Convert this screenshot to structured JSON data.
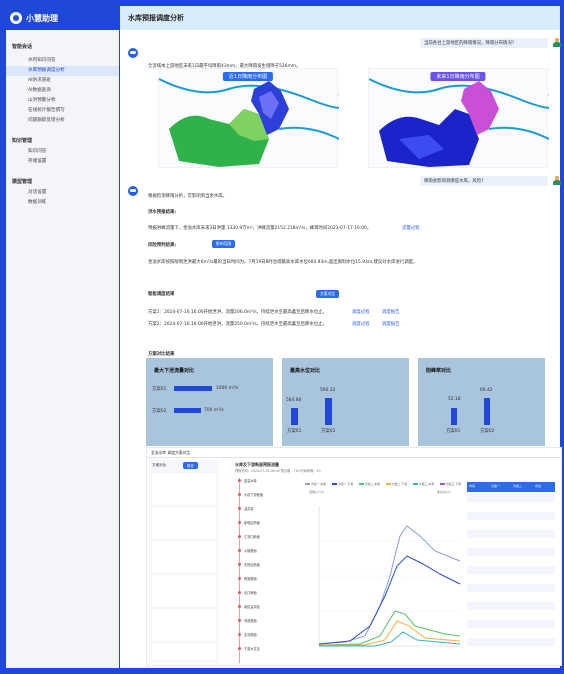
{
  "app": {
    "name": "小慧助理",
    "page_title": "水库预报调度分析"
  },
  "sidebar": {
    "sections": [
      {
        "title": "智能会话",
        "items": [
          "水利知识问答",
          "水库预报调度分析",
          "AI防汛值班",
          "AI数据查询",
          "山洪预警分析",
          "在线统计报告撰写",
          "问题跟踪反馈分析"
        ],
        "active": 1
      },
      {
        "title": "知识管理",
        "items": [
          "知识问答",
          "存储设置"
        ]
      },
      {
        "title": "模型管理",
        "items": [
          "对话设置",
          "数据训练"
        ]
      }
    ]
  },
  "chat": {
    "q1": "当前各台上游地区的降雨情况，降雨分布情况?",
    "a1": "全流域本上游地区未来1日最平均降雨43mm，最大降雨发生增降于526mm。",
    "map_left_title": "近1日降雨分布图",
    "map_right_title": "未来1日降雨分布图",
    "q2": "降雨会影响到哪些水库，风险?",
    "a2_intro": "根据检测降雨分析，可影响到当金水库。",
    "forecast_heading": "洪水预报结果:",
    "forecast_text": "预报洪峰流量下，金溢水库未来3日洪量 1330.9万m³，洪峰流量2152.218m³/s，峰现时间2023-07-17 16:00。",
    "forecast_link": "流量过程",
    "risk_heading": "风险预判结果:",
    "risk_button": "影响范围",
    "risk_text": "金溢水库按照限制泄洪最大6m³/s最的当日时间为，7月19日8时治理最高水库水位604.93m,超出限制水位15.93m,建议对水库进行调度。",
    "dispatch_heading": "智能调度结果",
    "dispatch_button": "方案对比",
    "plan1": "方案1：2024-07-16 16:00开始泄洪，流量206.0m³/s，持续泄水至最高蓄至后降水位止。",
    "plan2": "方案2：2024-07-16 16:00开始泄洪，流量250.0m³/s，持续泄水至最高蓄至后降水位止。",
    "plan_link1": "调度过程",
    "plan_link2": "调度报告",
    "compare_heading": "方案对比结果"
  },
  "cards": [
    {
      "title": "最大下泄流量对比",
      "bars": [
        {
          "label": "方案01",
          "value": 1000,
          "unit": "m³/s"
        },
        {
          "label": "方案02",
          "value": 700,
          "unit": "m³/s"
        }
      ]
    },
    {
      "title": "最高水位对比",
      "bars": [
        {
          "label": "方案01",
          "value": 584.86
        },
        {
          "label": "方案02",
          "value": 590.32
        }
      ]
    },
    {
      "title": "削峰率对比",
      "bars": [
        {
          "label": "方案01",
          "value": 52.18
        },
        {
          "label": "方案02",
          "value": 66.42
        }
      ]
    }
  ],
  "embedded": {
    "title": "金溢水库 调度方案对比",
    "tab_a": "方案对比",
    "tab_b": "报告",
    "chart_title": "水库及下游断面预报流量",
    "chart_subtitle": "预报时间：2024-07-16 08:00 预见期：72h 时间间隔：1h",
    "ylabel_left": "流量(m³/s)",
    "ylabel_right": "库水位(m)",
    "legend": [
      "方案一-水库",
      "方案一-下游",
      "方案二-水库",
      "方案二-下游",
      "方案三-水库",
      "方案三-下游"
    ],
    "station_list": [
      "金溢水库",
      "大坝下游断面",
      "溢洪道",
      "新城区断面",
      "汇流口断面",
      "乡镇断面",
      "农田区断面",
      "桥梁断面",
      "出口断面",
      "城区监测站",
      "河道断面",
      "支流断面",
      "下游水文站"
    ],
    "table_headers": [
      "时间",
      "方案一",
      "方案二",
      "水位"
    ]
  }
}
